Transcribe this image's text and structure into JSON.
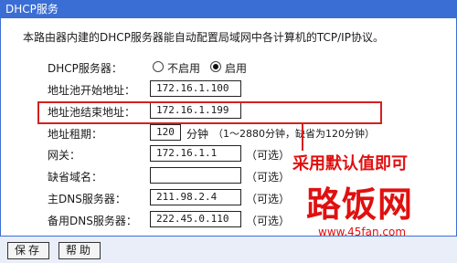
{
  "window": {
    "title": "DHCP服务"
  },
  "intro": "本路由器内建的DHCP服务器能自动配置局域网中各计算机的TCP/IP协议。",
  "dhcp_server": {
    "label": "DHCP服务器：",
    "options": [
      "不启用",
      "启用"
    ],
    "selected": "启用"
  },
  "fields": {
    "pool_start": {
      "label": "地址池开始地址：",
      "value": "172.16.1.100"
    },
    "pool_end": {
      "label": "地址池结束地址：",
      "value": "172.16.1.199"
    },
    "lease": {
      "label": "地址租期：",
      "value": "120",
      "unit": "分钟",
      "hint": "（1～2880分钟，缺省为120分钟）"
    },
    "gateway": {
      "label": "网关：",
      "value": "172.16.1.1",
      "hint": "（可选）"
    },
    "domain": {
      "label": "缺省域名：",
      "value": "",
      "hint": "（可选）"
    },
    "dns_primary": {
      "label": "主DNS服务器：",
      "value": "211.98.2.4",
      "hint": "（可选）"
    },
    "dns_backup": {
      "label": "备用DNS服务器：",
      "value": "222.45.0.110",
      "hint": "（可选）"
    }
  },
  "annotation": {
    "callout": "采用默认值即可",
    "color": "#e01010"
  },
  "watermark": {
    "text": "路饭网",
    "url": "www.45fan.com"
  },
  "buttons": {
    "save": "保存",
    "help": "帮助"
  },
  "colors": {
    "accent": "#3b6ed4",
    "highlight": "#d42020"
  }
}
